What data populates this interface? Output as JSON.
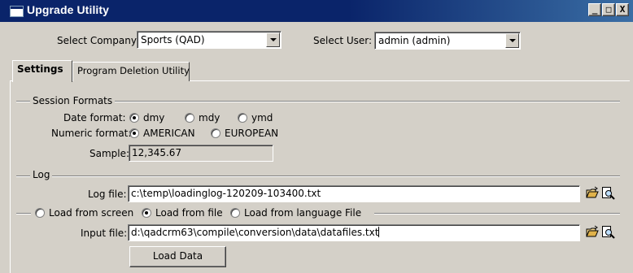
{
  "window": {
    "title": "Upgrade Utility",
    "minimize": "_",
    "restore": "□",
    "close": "X"
  },
  "header": {
    "company_label": "Select Company:",
    "company_value": "Sports (QAD)",
    "user_label": "Select User:",
    "user_value": "admin (admin)"
  },
  "tabs": [
    {
      "label": "Settings",
      "active": true
    },
    {
      "label": "Program Deletion Utility",
      "active": false
    }
  ],
  "session_formats": {
    "group_label": "Session Formats",
    "date_format_label": "Date format:",
    "date_options": [
      "dmy",
      "mdy",
      "ymd"
    ],
    "date_selected": "dmy",
    "numeric_format_label": "Numeric format:",
    "numeric_options": [
      "AMERICAN",
      "EUROPEAN"
    ],
    "numeric_selected": "AMERICAN",
    "sample_label": "Sample:",
    "sample_value": "12,345.67"
  },
  "log": {
    "group_label": "Log",
    "log_file_label": "Log file:",
    "log_file_value": "c:\\temp\\loadinglog-120209-103400.txt"
  },
  "load": {
    "options": [
      "Load from screen",
      "Load from file",
      "Load from language File"
    ],
    "selected": "Load from file",
    "input_file_label": "Input file:",
    "input_file_value": "d:\\qadcrm63\\compile\\conversion\\data\\datafiles.txt",
    "button_label": "Load Data"
  },
  "icons": [
    "app-window-icon",
    "open-folder-icon",
    "preview-icon"
  ],
  "colors": {
    "titlebar": "#0a246a",
    "face": "#d4d0c8"
  }
}
